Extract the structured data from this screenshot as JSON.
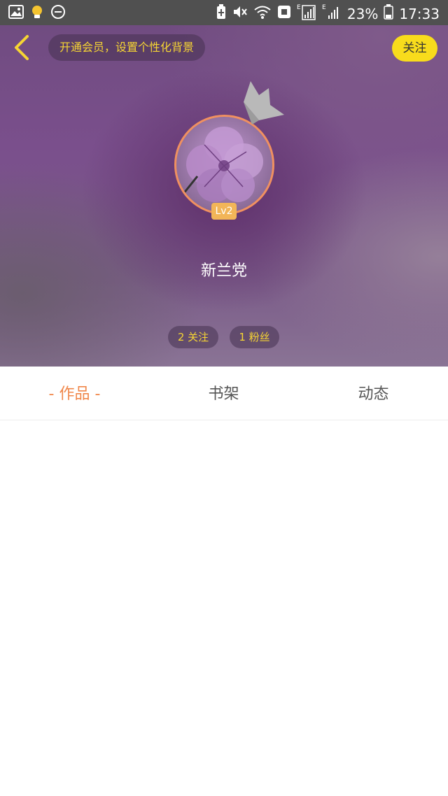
{
  "status_bar": {
    "left_icons": [
      "image-icon",
      "lightbulb-icon",
      "do-not-disturb-icon"
    ],
    "right_icons": [
      "battery-saver-icon",
      "mute-icon",
      "wifi-icon",
      "nfc-icon",
      "e-network-icon",
      "signal-icon",
      "e-network-icon",
      "signal-icon",
      "battery-icon"
    ],
    "battery": "23%",
    "time": "17:33"
  },
  "top_bar": {
    "vip_prompt": "开通会员，设置个性化背景",
    "follow_label": "关注"
  },
  "profile": {
    "username": "新兰党",
    "level": "Lv2",
    "following": "2 关注",
    "fans": "1 粉丝"
  },
  "tabs": [
    {
      "label": "作品",
      "active": true
    },
    {
      "label": "书架",
      "active": false
    },
    {
      "label": "动态",
      "active": false
    }
  ],
  "colors": {
    "accent": "#f0874a",
    "highlight": "#f6d533",
    "follow_button": "#f8dc1c"
  }
}
